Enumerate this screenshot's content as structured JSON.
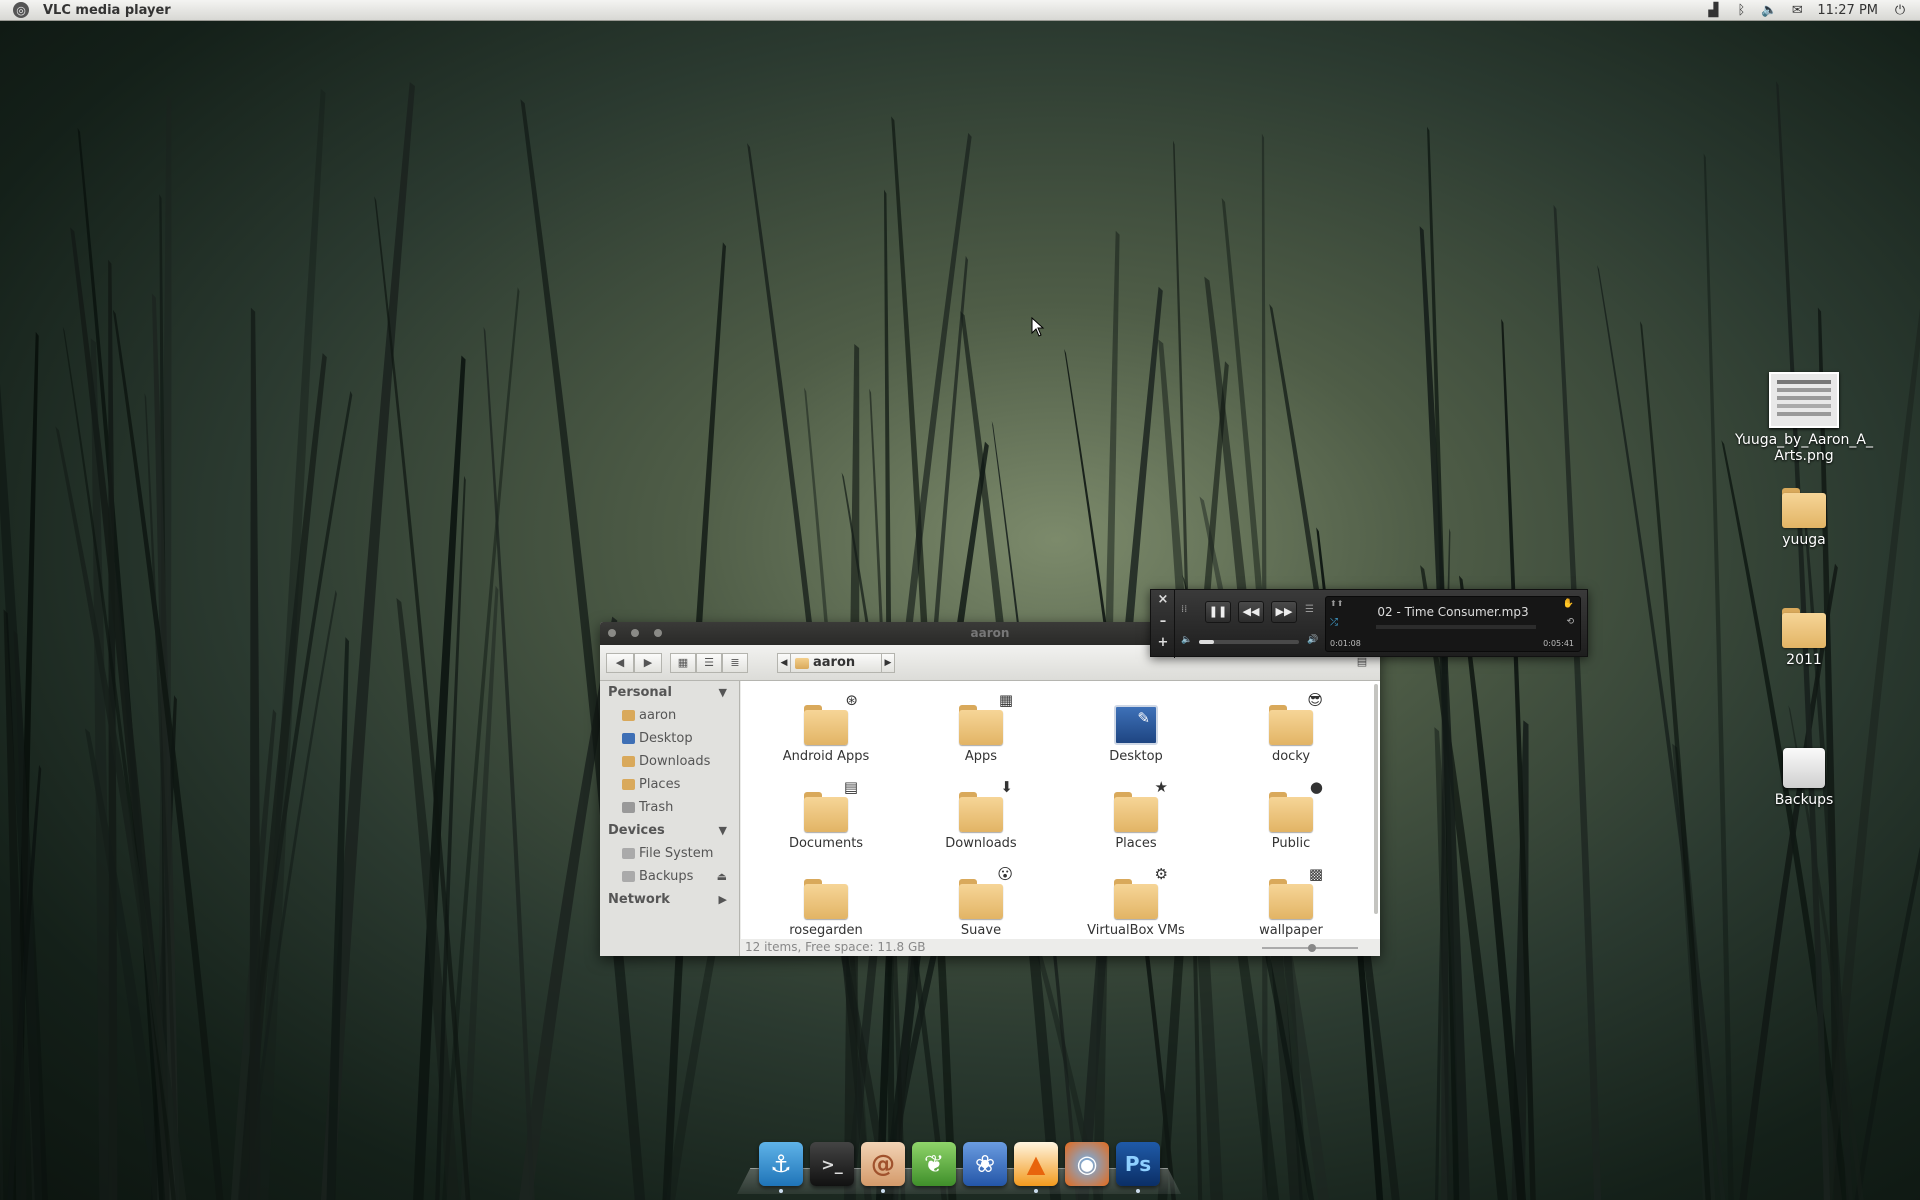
{
  "top_panel": {
    "app_title": "VLC media player",
    "tray_icons": [
      "network-icon",
      "bluetooth-icon",
      "volume-icon",
      "mail-icon"
    ],
    "clock": "11:27 PM"
  },
  "desktop_icons": [
    {
      "label": "Yuuga_by_Aaron_A_Arts.png",
      "icon": "image-file-icon"
    },
    {
      "label": "yuuga",
      "icon": "folder-icon"
    },
    {
      "label": "2011",
      "icon": "folder-icon"
    },
    {
      "label": "Backups",
      "icon": "drive-icon"
    }
  ],
  "file_manager": {
    "title": "aaron",
    "location": "aaron",
    "sidebar": {
      "personal_heading": "Personal",
      "personal_items": [
        "aaron",
        "Desktop",
        "Downloads",
        "Places",
        "Trash"
      ],
      "devices_heading": "Devices",
      "devices_items": [
        "File System",
        "Backups"
      ],
      "network_heading": "Network"
    },
    "items": [
      {
        "label": "Android Apps",
        "emblem": "⊛"
      },
      {
        "label": "Apps",
        "emblem": "▦"
      },
      {
        "label": "Desktop",
        "emblem": "✎"
      },
      {
        "label": "docky",
        "emblem": "😎"
      },
      {
        "label": "Documents",
        "emblem": "▤"
      },
      {
        "label": "Downloads",
        "emblem": "⬇"
      },
      {
        "label": "Places",
        "emblem": "★"
      },
      {
        "label": "Public",
        "emblem": "●"
      },
      {
        "label": "rosegarden",
        "emblem": ""
      },
      {
        "label": "Suave",
        "emblem": "😮"
      },
      {
        "label": "VirtualBox VMs",
        "emblem": "⚙"
      },
      {
        "label": "wallpaper",
        "emblem": "▩"
      }
    ],
    "status": "12 items, Free space: 11.8 GB"
  },
  "player": {
    "track": "02 - Time Consumer.mp3",
    "elapsed": "0:01:08",
    "total": "0:05:41",
    "volume_fraction": 0.15,
    "close_label": "×",
    "minus_label": "–",
    "plus_label": "+",
    "pause_label": "❚❚",
    "prev_label": "◀◀",
    "next_label": "▶▶"
  },
  "dock": {
    "items": [
      "anchor-icon",
      "terminal-icon",
      "shell-icon",
      "leaf-icon",
      "paw-icon",
      "vlc-icon",
      "firefox-icon",
      "photoshop-icon"
    ],
    "ps_label": "Ps"
  }
}
